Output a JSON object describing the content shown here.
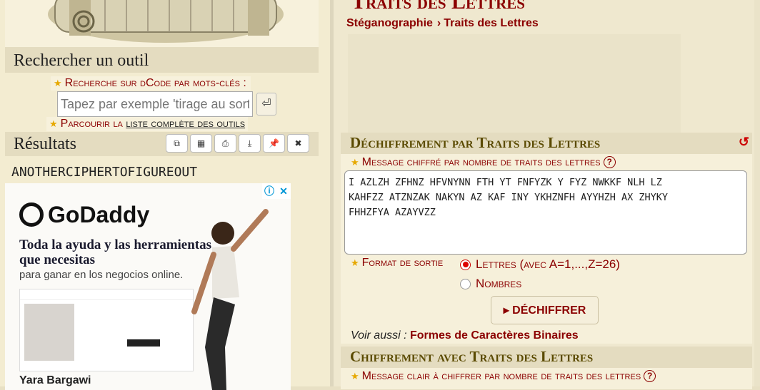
{
  "sidebar": {
    "search_section_title": "Rechercher un outil",
    "search_label": "Recherche sur dCode par mots-clés :",
    "search_placeholder": "Tapez par exemple 'tirage au sort'",
    "search_go": "⏎",
    "browse_prefix": "Parcourir la ",
    "browse_link": "liste complète des outils",
    "results_title": "Résultats",
    "result_buttons": [
      "copy-icon",
      "calculator-icon",
      "print-icon",
      "download-icon",
      "pin-icon",
      "close-icon"
    ],
    "result_text": "ANOTHERCIPHERTOFIGUREOUT"
  },
  "ad": {
    "brand": "GoDaddy",
    "headline": "Toda la ayuda y las herramientas que necesitas",
    "subline": "para ganar en los negocios online.",
    "caption": "Yara Bargawi",
    "info_icon": "ⓘ",
    "close_icon": "✕"
  },
  "main": {
    "page_title": "Traits des Lettres",
    "breadcrumb": [
      "Stéganographie",
      "Traits des Lettres"
    ],
    "breadcrumb_sep": "›",
    "decrypt_panel": {
      "title": "Déchiffrement par Traits des Lettres",
      "reset_icon": "↺",
      "message_label": "Message chiffré par nombre de traits des lettres",
      "message_value": "I AZLZH ZFHNZ HFVNYNN FTH YT FNFYZK Y FYZ NWKKF NLH LZ\nKAHFZZ ATZNZAK NAKYN AZ KAF INY YKHZNFH AYYHZH AX ZHYKY\nFHHZFYA AZAYVZZ",
      "format_label": "Format de sortie",
      "format_options": [
        "Lettres (avec A=1,...,Z=26)",
        "Nombres"
      ],
      "format_selected": "Lettres (avec A=1,...,Z=26)",
      "decrypt_button": "▸ DÉCHIFFRER",
      "see_also_label": "Voir aussi : ",
      "see_also_link": "Formes de Caractères Binaires"
    },
    "encrypt_panel": {
      "title": "Chiffrement avec Traits des Lettres",
      "message_label": "Message clair à chiffrer par nombre de traits des lettres"
    }
  },
  "colors": {
    "accent": "#8b0000",
    "panel_bg": "#f6f0da",
    "header_bg": "#e4dcc0"
  }
}
